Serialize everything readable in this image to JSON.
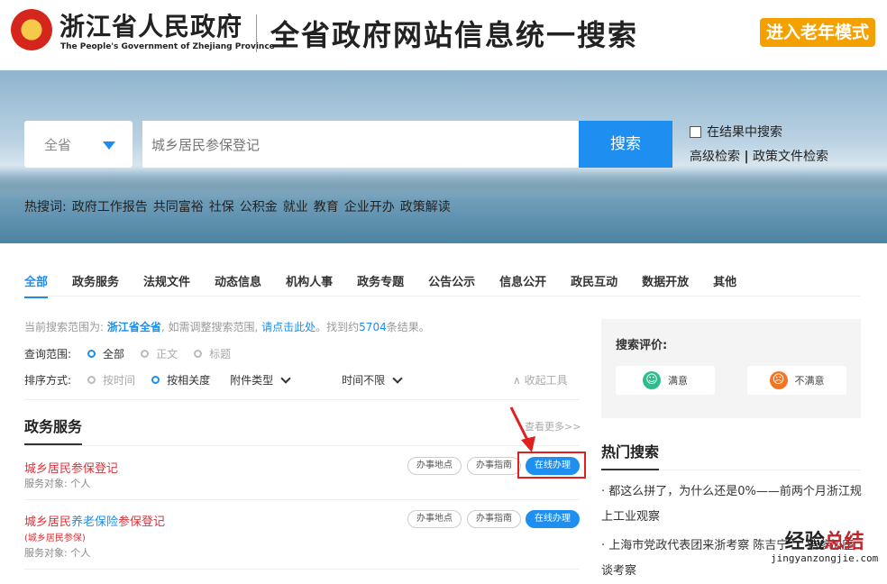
{
  "header": {
    "org_cn": "浙江省人民政府",
    "org_en": "The People's Government of Zhejiang Province",
    "site_title": "全省政府网站信息统一搜索",
    "elder_mode": "进入老年模式"
  },
  "search": {
    "scope": "全省",
    "query": "城乡居民参保登记",
    "button": "搜索",
    "in_results": "在结果中搜索",
    "advanced": "高级检索",
    "divider": "|",
    "policy": "政策文件检索"
  },
  "hot_words": {
    "label": "热搜词:",
    "items": [
      "政府工作报告",
      "共同富裕",
      "社保",
      "公积金",
      "就业",
      "教育",
      "企业开办",
      "政策解读"
    ]
  },
  "tabs": [
    "全部",
    "政务服务",
    "法规文件",
    "动态信息",
    "机构人事",
    "政务专题",
    "公告公示",
    "信息公开",
    "政民互动",
    "数据开放",
    "其他"
  ],
  "info": {
    "prefix": "当前搜索范围为: ",
    "scope": "浙江省全省",
    "mid": ", 如需调整搜索范围, ",
    "link": "请点击此处",
    "found": "。找到约",
    "count": "5704",
    "suffix": "条结果。"
  },
  "filters": {
    "range_label": "查询范围:",
    "range_opts": [
      "全部",
      "正文",
      "标题"
    ],
    "sort_label": "排序方式:",
    "sort_opts": [
      "按时间",
      "按相关度"
    ],
    "attach": "附件类型",
    "time": "时间不限",
    "collapse": "收起工具"
  },
  "section": {
    "title": "政务服务",
    "more": "查看更多>>"
  },
  "results": [
    {
      "title": "城乡居民参保登记",
      "target": "服务对象: 个人",
      "buttons": [
        "办事地点",
        "办事指南",
        "在线办理"
      ]
    },
    {
      "title_a": "城乡居民",
      "title_b": "养老保险",
      "title_c": "参保登记",
      "alias": "(城乡居民参保)",
      "target": "服务对象: 个人",
      "buttons": [
        "办事地点",
        "办事指南",
        "在线办理"
      ]
    }
  ],
  "rating": {
    "title": "搜索评价:",
    "good": "满意",
    "bad": "不满意"
  },
  "hot_search": {
    "title": "热门搜索",
    "items": [
      "· 都这么拼了，为什么还是0%——前两个月浙江规上工业观察",
      "· 上海市党政代表团来浙考察 陈吉宁 ... 浩参加座谈考察"
    ]
  },
  "watermark": {
    "cn_a": "经验",
    "cn_b": "总结",
    "url": "jingyanzongjie.com"
  },
  "colors": {
    "accent": "#1e8ff0",
    "title_red": "#d9343b",
    "elder": "#f4a100"
  }
}
